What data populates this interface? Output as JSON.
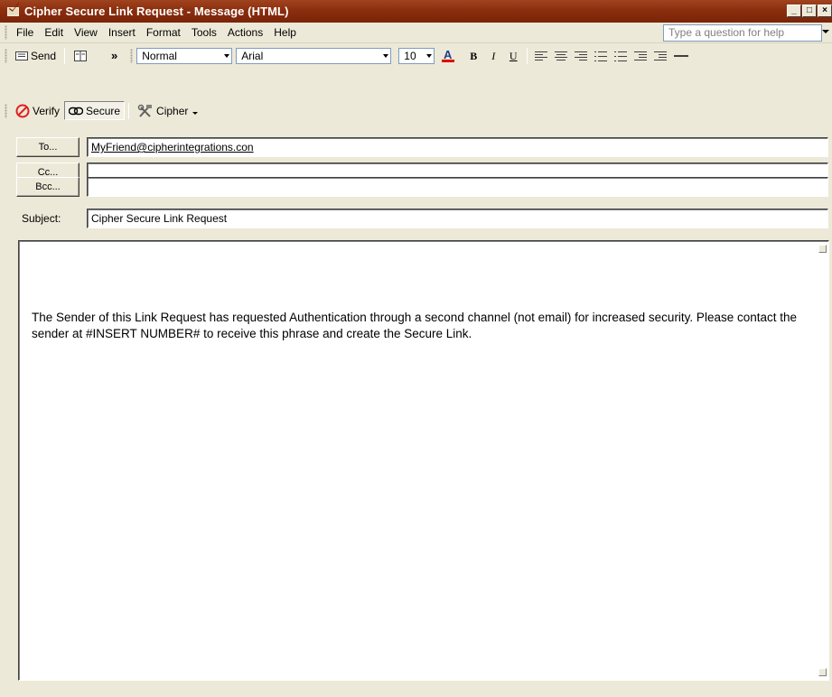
{
  "window": {
    "title": "Cipher Secure Link Request - Message (HTML)",
    "buttons": [
      "_",
      "□",
      "×"
    ]
  },
  "menubar": {
    "items": [
      {
        "label": "File",
        "underline": "F"
      },
      {
        "label": "Edit",
        "underline": "E"
      },
      {
        "label": "View",
        "underline": "V"
      },
      {
        "label": "Insert",
        "underline": "I"
      },
      {
        "label": "Format",
        "underline": "o"
      },
      {
        "label": "Tools",
        "underline": "T"
      },
      {
        "label": "Actions",
        "underline": "A"
      },
      {
        "label": "Help",
        "underline": "H"
      }
    ],
    "help_placeholder": "Type a question for help"
  },
  "toolbar1": {
    "send_label": "Send",
    "style_value": "Normal",
    "font_value": "Arial",
    "size_value": "10",
    "bold": "B",
    "italic": "I",
    "underline": "U",
    "overflow": "»"
  },
  "toolbar2": {
    "verify_label": "Verify",
    "secure_label": "Secure",
    "cipher_label": "Cipher"
  },
  "header": {
    "to_label": "To...",
    "to_value": "MyFriend@cipherintegrations.con",
    "cc_label": "Cc...",
    "cc_value": "",
    "bcc_label": "Bcc...",
    "bcc_value": "",
    "subject_label": "Subject:",
    "subject_value": "Cipher Secure Link Request"
  },
  "message": {
    "body": "The Sender of this Link Request has requested Authentication through a second channel (not email) for increased security.  Please contact the sender at #INSERT NUMBER# to receive this phrase and create the Secure Link."
  },
  "colors": {
    "titlebar": "#8b2e0e",
    "chrome": "#ece9d8",
    "verify_icon": "#e02020",
    "font_color_bar": "#e00000"
  }
}
